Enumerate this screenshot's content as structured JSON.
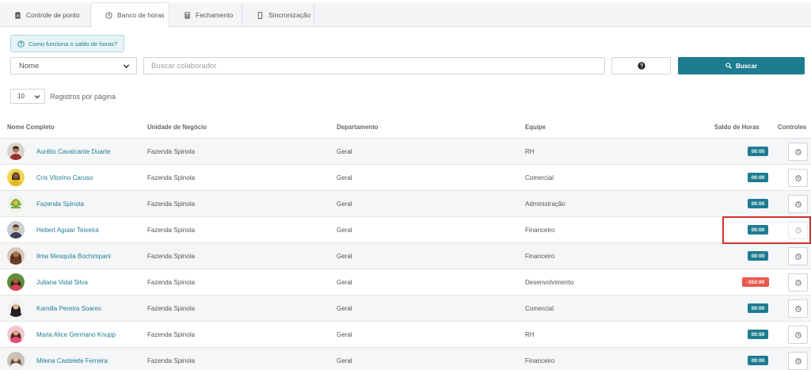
{
  "tabs": [
    {
      "label": "Controle de ponto",
      "icon": "clipboard-icon",
      "active": false
    },
    {
      "label": "Banco de horas",
      "icon": "clock-icon",
      "active": true
    },
    {
      "label": "Fechamento",
      "icon": "calculator-icon",
      "active": false
    },
    {
      "label": "Sincronização",
      "icon": "mobile-icon",
      "active": false
    }
  ],
  "help": {
    "label": "Como funciona o saldo de horas?"
  },
  "search": {
    "field_selected": "Nome",
    "placeholder": "Buscar colaborador",
    "button_label": "Buscar"
  },
  "pagination": {
    "per_page": "10",
    "per_page_label": "Registros por página"
  },
  "table": {
    "headers": {
      "name": "Nome Completo",
      "unit": "Unidade de Negócio",
      "department": "Departamento",
      "team": "Equipe",
      "balance": "Saldo de Horas",
      "controls": "Controles"
    },
    "rows": [
      {
        "name": "Aurélio Cavalcante Duarte",
        "unit": "Fazenda Spinola",
        "department": "Geral",
        "team": "RH",
        "balance": "00:00"
      },
      {
        "name": "Cris Vitorino Caruso",
        "unit": "Fazenda Spinola",
        "department": "Geral",
        "team": "Comercial",
        "balance": "00:00"
      },
      {
        "name": "Fazenda Spinola",
        "unit": "Fazenda Spinola",
        "department": "Geral",
        "team": "Administração",
        "balance": "00:00"
      },
      {
        "name": "Hebert Aguiar Teixeira",
        "unit": "Fazenda Spinola",
        "department": "Geral",
        "team": "Financeiro",
        "balance": "00:00"
      },
      {
        "name": "Ilma Mesquita Bochimpani",
        "unit": "Fazenda Spinola",
        "department": "Geral",
        "team": "Financeiro",
        "balance": "00:00"
      },
      {
        "name": "Juliana Vidal Silva",
        "unit": "Fazenda Spinola",
        "department": "Geral",
        "team": "Desenvolvimento",
        "balance": "-352:00"
      },
      {
        "name": "Kamilla Pereira Soares",
        "unit": "Fazenda Spinola",
        "department": "Geral",
        "team": "Comercial",
        "balance": "00:00"
      },
      {
        "name": "Maria Alice Germano Knupp",
        "unit": "Fazenda Spinola",
        "department": "Geral",
        "team": "RH",
        "balance": "00:00"
      },
      {
        "name": "Milena Castelete Ferreira",
        "unit": "Fazenda Spinola",
        "department": "Geral",
        "team": "Financeiro",
        "balance": "00:00"
      }
    ]
  },
  "colors": {
    "accent": "#1e7c91",
    "negative": "#e8594f",
    "highlight": "#d0312d"
  }
}
